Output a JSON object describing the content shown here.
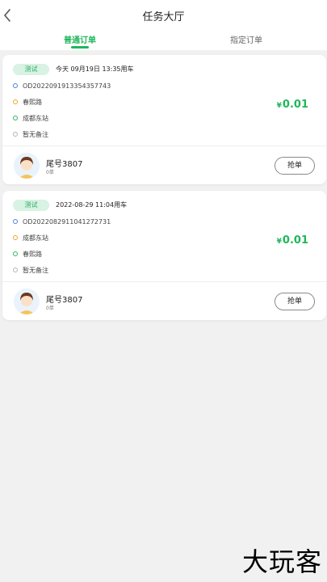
{
  "header": {
    "title": "任务大厅",
    "tabs": [
      {
        "label": "普通订单",
        "active": true
      },
      {
        "label": "指定订单",
        "active": false
      }
    ]
  },
  "orders": [
    {
      "tag": "测试",
      "time": "今天 09月19日 13:35用车",
      "order_id": "OD2022091913354357743",
      "start": "春熙路",
      "end": "成都东站",
      "note": "暂无备注",
      "price_symbol": "¥",
      "price": "0.01",
      "user_name": "尾号3807",
      "user_sub": "0单",
      "action": "抢单"
    },
    {
      "tag": "测试",
      "time": "2022-08-29 11:04用车",
      "order_id": "OD2022082911041272731",
      "start": "成都东站",
      "end": "春熙路",
      "note": "暂无备注",
      "price_symbol": "¥",
      "price": "0.01",
      "user_name": "尾号3807",
      "user_sub": "0单",
      "action": "抢单"
    }
  ],
  "watermark": "大玩客",
  "colors": {
    "accent": "#1fb75a",
    "tag_bg": "#d8f2e3",
    "page_bg": "#f1f1f1"
  }
}
